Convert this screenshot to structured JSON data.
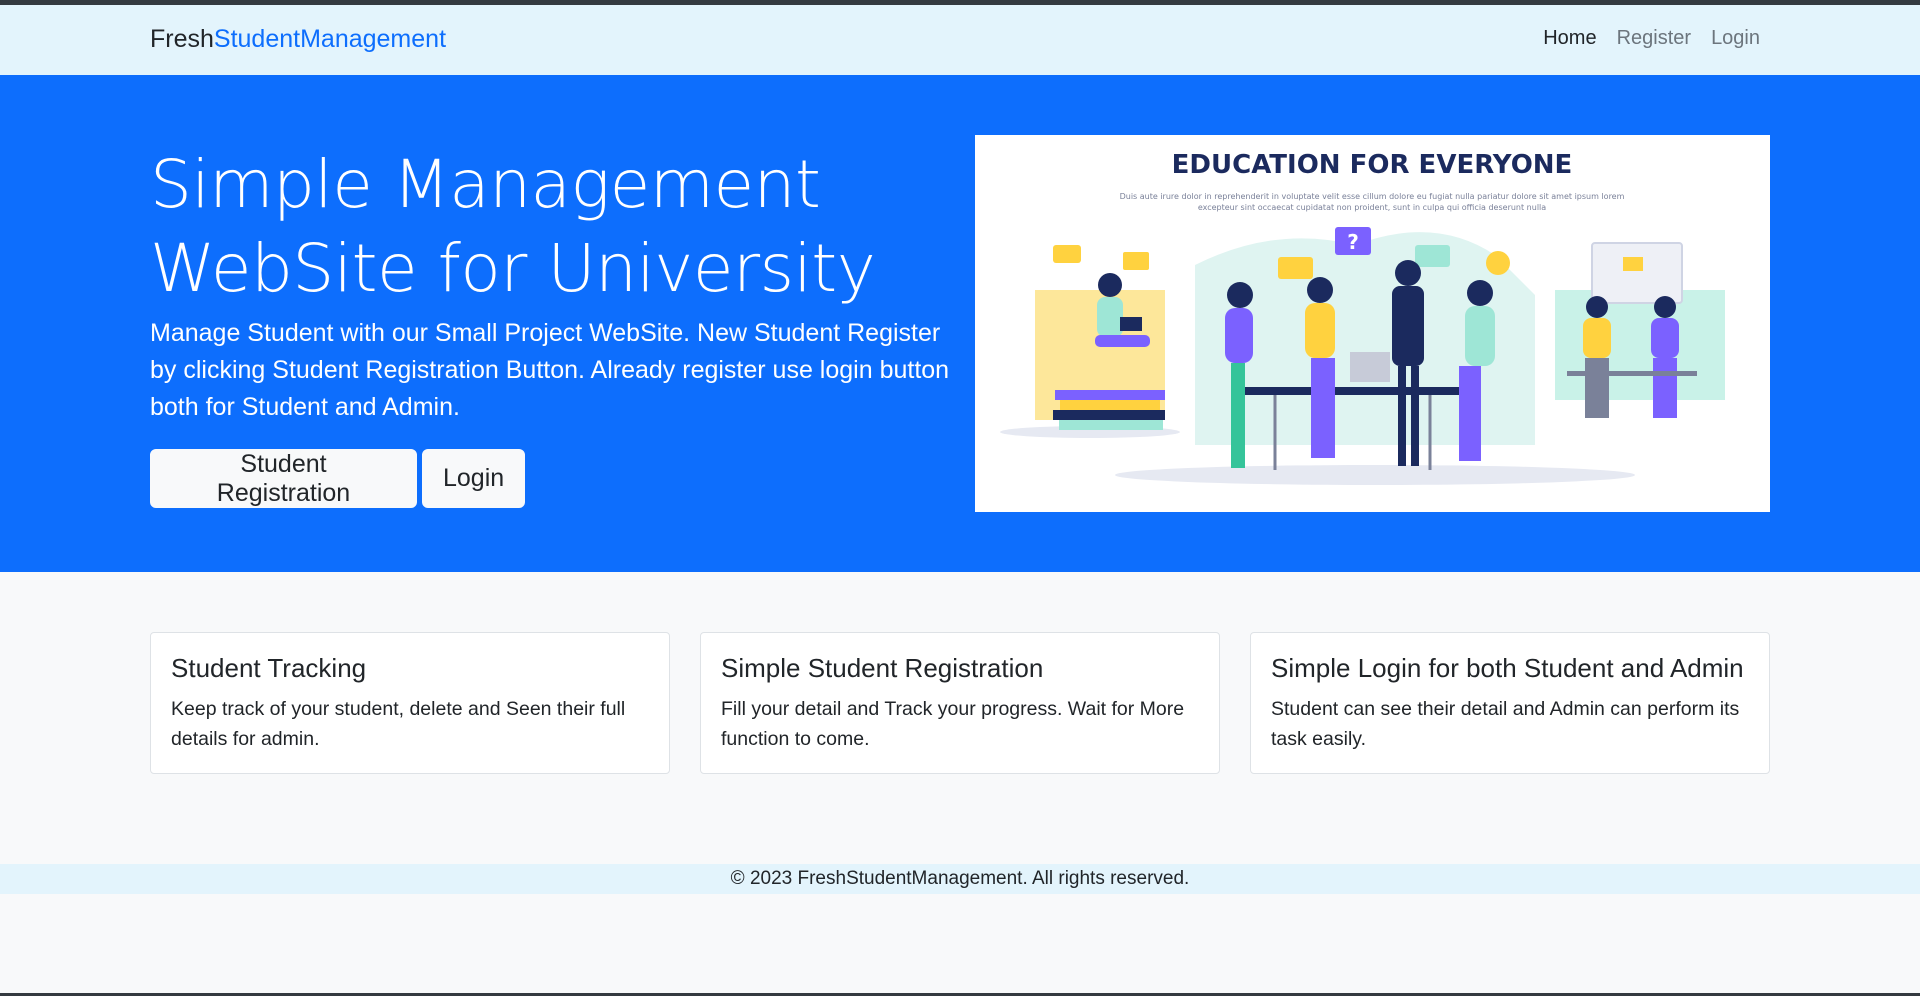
{
  "navbar": {
    "brand_prefix": "Fresh",
    "brand_accent": "StudentManagement",
    "links": [
      {
        "label": "Home",
        "active": true
      },
      {
        "label": "Register",
        "active": false
      },
      {
        "label": "Login",
        "active": false
      }
    ]
  },
  "hero": {
    "title_line1": "Simple Management",
    "title_line2": "WebSite for University",
    "description": "Manage Student with our Small Project WebSite. New Student Register by clicking Student Registration Button. Already register use login button both for Student and Admin.",
    "register_button": "Student Registration",
    "login_button": "Login",
    "image": {
      "heading": "EDUCATION FOR EVERYONE",
      "caption_line1": "Duis aute irure dolor in reprehenderit in voluptate velit esse cillum dolore eu fugiat nulla pariatur dolore sit amet ipsum lorem",
      "caption_line2": "excepteur sint occaecat cupidatat non proident, sunt in culpa qui officia deserunt nulla"
    }
  },
  "features": [
    {
      "title": "Student Tracking",
      "text": "Keep track of your student, delete and Seen their full details for admin."
    },
    {
      "title": "Simple Student Registration",
      "text": "Fill your detail and Track your progress. Wait for More function to come."
    },
    {
      "title": "Simple Login for both Student and Admin",
      "text": "Student can see their detail and Admin can perform its task easily."
    }
  ],
  "footer": {
    "text": "© 2023 FreshStudentManagement. All rights reserved."
  },
  "colors": {
    "primary": "#0d6efd",
    "navbar_bg": "#e3f4fc",
    "page_bg": "#f8f9fa",
    "illustration_navy": "#1b2a5e",
    "illustration_purple": "#7b61ff",
    "illustration_yellow": "#ffd23f",
    "illustration_mint": "#9ee6d6"
  }
}
